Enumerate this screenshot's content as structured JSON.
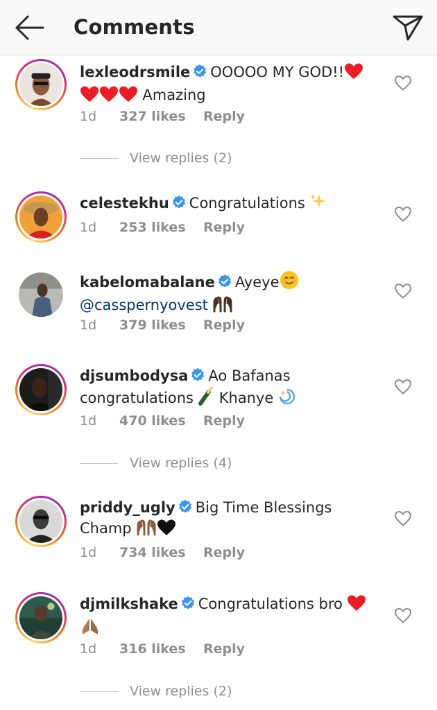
{
  "header": {
    "title": "Comments",
    "back_icon": "arrow-left-icon",
    "share_icon": "paper-plane-icon"
  },
  "colors": {
    "verified": "#3897f0",
    "mention": "#00376b",
    "meta": "#8e8e8e",
    "heart_red": "#ed1c24"
  },
  "comments": [
    {
      "username": "lexleodrsmile",
      "text_line1": "OOOOO MY GOD!!",
      "text_line2": "Amazing",
      "time": "1d",
      "likes": "327 likes",
      "reply": "Reply",
      "view_replies": "View replies (2)"
    },
    {
      "username": "celestekhu",
      "text_line1": "Congratulations",
      "time": "1d",
      "likes": "253 likes",
      "reply": "Reply"
    },
    {
      "username": "kabelomabalane",
      "text_line1": "Ayeye",
      "mention": "@casspernyovest",
      "time": "1d",
      "likes": "379 likes",
      "reply": "Reply"
    },
    {
      "username": "djsumbodysa",
      "text_line1": "Ao Bafanas",
      "text_line2a": "congratulations",
      "text_line2b": "Khanye",
      "time": "1d",
      "likes": "470 likes",
      "reply": "Reply",
      "view_replies": "View replies (4)"
    },
    {
      "username": "priddy_ugly",
      "text_line1": "Big Time Blessings",
      "text_line2": "Champ",
      "time": "1d",
      "likes": "734 likes",
      "reply": "Reply"
    },
    {
      "username": "djmilkshake",
      "text_line1": "Congratulations bro",
      "time": "1d",
      "likes": "316 likes",
      "reply": "Reply",
      "view_replies": "View replies (2)"
    }
  ]
}
